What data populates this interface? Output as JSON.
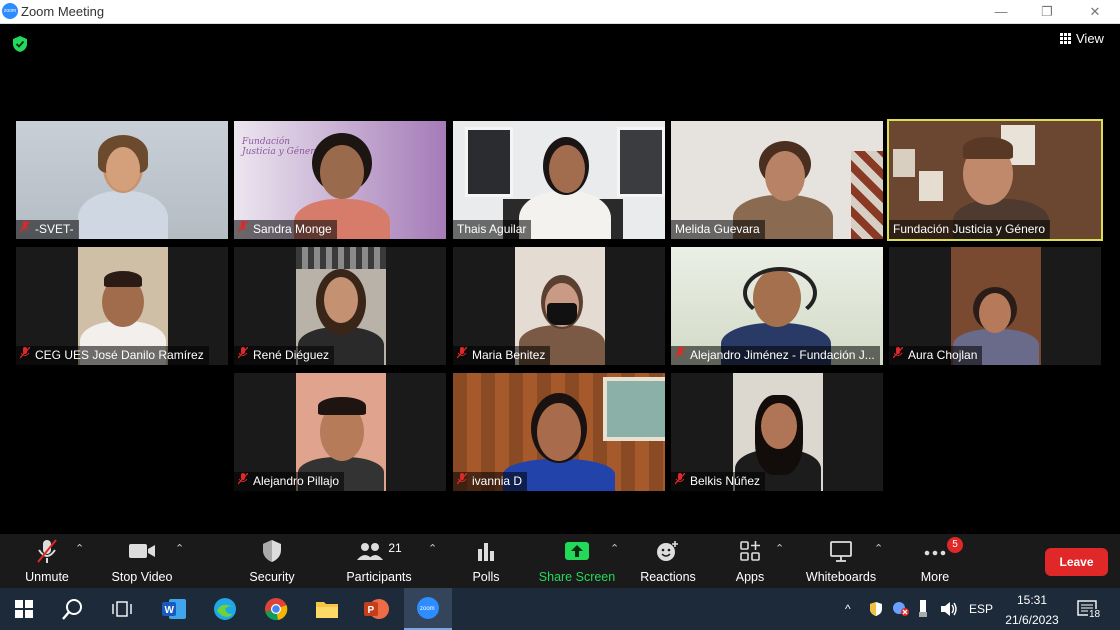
{
  "window": {
    "title": "Zoom Meeting",
    "minimize": "—",
    "restore": "❐",
    "close": "✕"
  },
  "top": {
    "view_label": "View"
  },
  "participants_tiles": [
    {
      "name": "-SVET-",
      "muted": true
    },
    {
      "name": "Sandra Monge",
      "muted": true,
      "bg_text": "Fundación\nJusticia y Género"
    },
    {
      "name": "Thais Aguilar",
      "muted": false
    },
    {
      "name": "Melida Guevara",
      "muted": false
    },
    {
      "name": "Fundación Justicia y Género",
      "muted": false,
      "active_speaker": true
    },
    {
      "name": "CEG UES José Danilo Ramírez",
      "muted": true
    },
    {
      "name": "René Diéguez",
      "muted": true
    },
    {
      "name": "Maria Benitez",
      "muted": true
    },
    {
      "name": "Alejandro Jiménez - Fundación J...",
      "muted": true
    },
    {
      "name": "Aura Chojlan",
      "muted": true
    },
    {
      "name": "Alejandro Pillajo",
      "muted": true
    },
    {
      "name": "ivannia D",
      "muted": true
    },
    {
      "name": "Belkis Núñez",
      "muted": true
    }
  ],
  "toolbar": {
    "unmute": "Unmute",
    "stop_video": "Stop Video",
    "security": "Security",
    "participants": "Participants",
    "participants_count": "21",
    "polls": "Polls",
    "share_screen": "Share Screen",
    "reactions": "Reactions",
    "apps": "Apps",
    "whiteboards": "Whiteboards",
    "more": "More",
    "more_badge": "5",
    "leave": "Leave"
  },
  "taskbar": {
    "language": "ESP",
    "time": "15:31",
    "date": "21/6/2023",
    "notifications": "18"
  },
  "colors": {
    "accent_green": "#23d959",
    "active_border": "#d9de56",
    "leave_red": "#e02828",
    "muted_red": "#e02828"
  }
}
